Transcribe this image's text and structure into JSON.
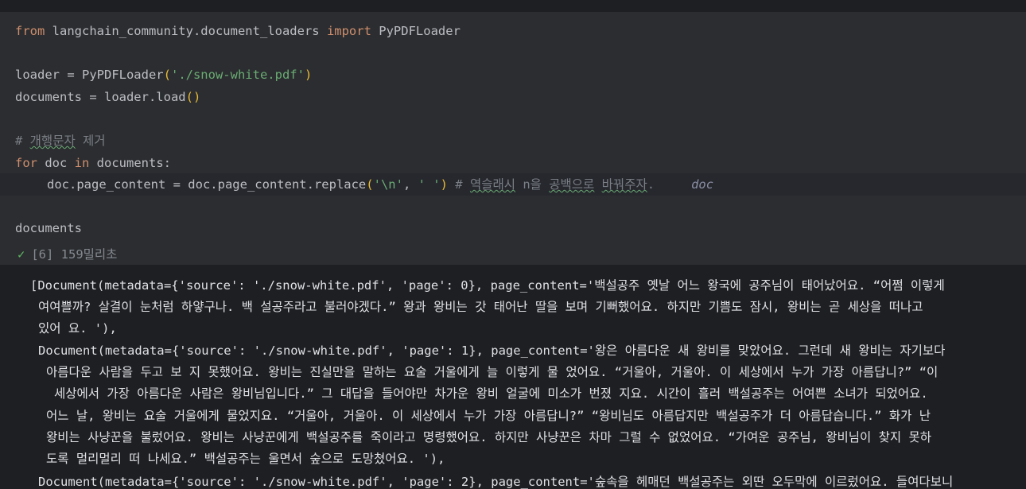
{
  "cell": {
    "code_lines": [
      [
        "from",
        " langchain_community.document_loaders ",
        "import",
        " PyPDFLoader"
      ],
      [
        "loader = PyPDFLoader",
        "(",
        "'./snow-white.pdf'",
        ")"
      ],
      [
        "documents = loader.load",
        "()"
      ],
      [
        "# ",
        "개행문자",
        " 제거"
      ],
      [
        "for",
        " doc ",
        "in",
        " documents:"
      ],
      [
        "doc.page_content = doc.page_content.replace",
        "(",
        "'\\n'",
        ", ",
        "' '",
        ")",
        " # ",
        "역슬래시",
        " n을 ",
        "공백으로",
        " ",
        "바꿔주자",
        "."
      ],
      [
        "documents"
      ]
    ],
    "inline_hint": "doc",
    "run_status": "[6] 159밀리초"
  },
  "output": {
    "lines": [
      "[Document(metadata={'source': './snow-white.pdf', 'page': 0}, page_content='백설공주 옛날 어느 왕국에 공주님이 태어났어요. “어쩜 이렇게",
      "여여쁠까? 살결이 눈처럼 하얗구나. 백 설공주라고 불러야겠다.” 왕과 왕비는 갓 태어난 딸을 보며 기뻐했어요. 하지만 기쁨도 잠시, 왕비는 곧 세상을 떠나고",
      "있어 요. '),",
      "Document(metadata={'source': './snow-white.pdf', 'page': 1}, page_content='왕은 아름다운 새 왕비를 맞았어요. 그런데 새 왕비는 자기보다",
      "아름다운 사람을 두고 보 지 못했어요. 왕비는 진실만을 말하는 요술 거울에게 늘 이렇게 물 었어요. “거울아, 거울아. 이 세상에서 누가 가장 아름답니?” “이",
      "세상에서 가장 아름다운 사람은 왕비님입니다.” 그 대답을 들어야만 차가운 왕비 얼굴에 미소가 번졌 지요. 시간이 흘러 백설공주는 어여쁜 소녀가 되었어요.",
      "어느 날, 왕비는 요술 거울에게 물었지요. “거울아, 거울아. 이 세상에서 누가 가장 아름답니?” “왕비님도 아름답지만 백설공주가 더 아름답습니다.” 화가 난",
      "왕비는 사냥꾼을 불렀어요. 왕비는 사냥꾼에게 백설공주를 죽이라고 명령했어요. 하지만 사냥꾼은 차마 그럴 수 없었어요. “가여운 공주님, 왕비님이 찾지 못하",
      "도록 멀리멀리 떠 나세요.” 백설공주는 울면서 숲으로 도망쳤어요. '),",
      "Document(metadata={'source': './snow-white.pdf', 'page': 2}, page_content='숲속을 헤매던 백설공주는 외딴 오두막에 이르렀어요. 들여다보니"
    ]
  }
}
